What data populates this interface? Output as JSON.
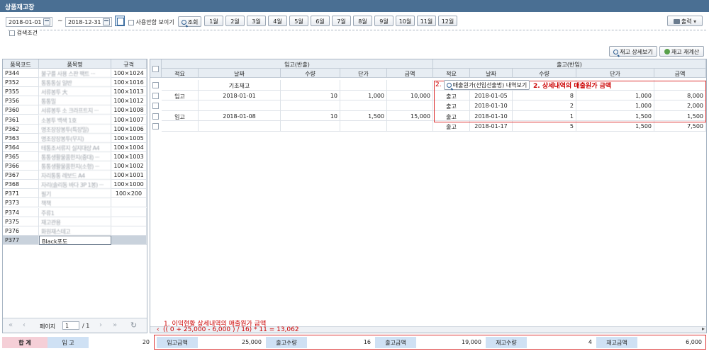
{
  "window": {
    "title": "상품재고장"
  },
  "toolbar": {
    "date_from": "2018-01-01",
    "date_sep": "~",
    "date_to": "2018-12-31",
    "show_unused_label": "사용안함 보이기",
    "search_label": "조회",
    "months": [
      "1월",
      "2월",
      "3월",
      "4월",
      "5월",
      "6월",
      "7월",
      "8월",
      "9월",
      "10월",
      "11월",
      "12월"
    ],
    "print_label": "출력",
    "search_condition_label": "검색조건"
  },
  "actions": {
    "detail_label": "재고 상세보기",
    "recalc_label": "재고 재계산"
  },
  "product_list": {
    "headers": [
      "품목코드",
      "품목명",
      "규격"
    ],
    "rows": [
      {
        "code": "P344",
        "name": "불구를 사용 스판 팩트 ···",
        "spec": "100×1024"
      },
      {
        "code": "P352",
        "name": "통통통실 일반",
        "spec": "100×1016"
      },
      {
        "code": "P355",
        "name": "서류봉투 大",
        "spec": "100×1013"
      },
      {
        "code": "P356",
        "name": "통통밀",
        "spec": "100×1012"
      },
      {
        "code": "P360",
        "name": "서류봉투 소 크라프트지 ···",
        "spec": "100×1008"
      },
      {
        "code": "P361",
        "name": "소봉투 백색 1호",
        "spec": "100×1007"
      },
      {
        "code": "P362",
        "name": "명조장장봉투(특장밀)",
        "spec": "100×1006"
      },
      {
        "code": "P363",
        "name": "명조장장봉투(무지)",
        "spec": "100×1005"
      },
      {
        "code": "P364",
        "name": "테통조서류지 실지대상 A4",
        "spec": "100×1004"
      },
      {
        "code": "P365",
        "name": "통통생활물품한지(중대) ···",
        "spec": "100×1003"
      },
      {
        "code": "P366",
        "name": "통통생활물품한지(소형) ···",
        "spec": "100×1002"
      },
      {
        "code": "P367",
        "name": "자리통통 레보드 A4",
        "spec": "100×1001"
      },
      {
        "code": "P368",
        "name": "자리(솔리동 바다 3P 1봉) ···",
        "spec": "100×1000"
      },
      {
        "code": "P371",
        "name": "필기",
        "spec": "100×200"
      },
      {
        "code": "P373",
        "name": "책책",
        "spec": ""
      },
      {
        "code": "P374",
        "name": "주류1",
        "spec": ""
      },
      {
        "code": "P375",
        "name": "재고관용",
        "spec": ""
      },
      {
        "code": "P376",
        "name": "화원재스테고",
        "spec": ""
      },
      {
        "code": "P377",
        "name": "Black포도",
        "spec": ""
      }
    ],
    "pager": {
      "page_label": "페이지",
      "page": "1",
      "total": "/ 1"
    }
  },
  "ledger": {
    "in_group": "입고(반출)",
    "out_group": "출고(반입)",
    "in_headers": [
      "적요",
      "날짜",
      "수량",
      "단가",
      "금액"
    ],
    "out_headers": [
      "적요",
      "날짜",
      "수량",
      "단가",
      "금액"
    ],
    "rows": [
      {
        "in": [
          "",
          "기초재고",
          "",
          "",
          ""
        ],
        "out": [
          "",
          "",
          "",
          "",
          ""
        ]
      },
      {
        "in": [
          "입고",
          "2018-01-01",
          "10",
          "1,000",
          "10,000"
        ],
        "out": [
          "출고",
          "2018-01-05",
          "8",
          "1,000",
          "8,000"
        ]
      },
      {
        "in": [
          "",
          "",
          "",
          "",
          ""
        ],
        "out": [
          "출고",
          "2018-01-10",
          "2",
          "1,000",
          "2,000"
        ]
      },
      {
        "in": [
          "입고",
          "2018-01-08",
          "10",
          "1,500",
          "15,000"
        ],
        "out": [
          "출고",
          "2018-01-10",
          "1",
          "1,500",
          "1,500"
        ]
      },
      {
        "in": [
          "",
          "",
          "",
          "",
          ""
        ],
        "out": [
          "출고",
          "2018-01-17",
          "5",
          "1,500",
          "7,500"
        ]
      }
    ],
    "popup_button": "매출원가(선입선출법) 내역보기"
  },
  "annotations": {
    "note2": "2. 상세내역의 매출원가 금액",
    "note1": "1. 이익현황 상세내역의 매출원가 금액",
    "formula": "(( 0 + 25,000 - 6,000 ) / 16) * 11 = 13,062"
  },
  "totals": {
    "sum_label": "합 계",
    "in_label": "입 고",
    "in_value": "20",
    "in_amount_label": "입고금액",
    "in_amount": "25,000",
    "out_qty_label": "출고수량",
    "out_qty": "16",
    "out_amount_label": "출고금액",
    "out_amount": "19,000",
    "stock_qty_label": "재고수량",
    "stock_qty": "4",
    "stock_amount_label": "재고금액",
    "stock_amount": "6,000"
  }
}
